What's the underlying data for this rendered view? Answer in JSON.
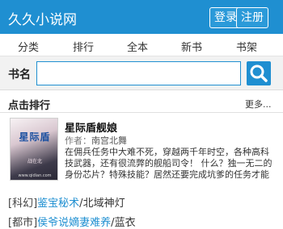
{
  "header": {
    "site_title": "久久小说网",
    "login_label": "登录",
    "register_label": "注册"
  },
  "nav": {
    "items": [
      "分类",
      "排行",
      "全本",
      "新书",
      "书架"
    ]
  },
  "search": {
    "label": "书名",
    "value": "",
    "placeholder": ""
  },
  "section": {
    "title": "点击排行",
    "more_label": "更多..."
  },
  "featured_book": {
    "cover_title": "星际盾",
    "cover_subtitle": "战在北",
    "cover_url": "www.qidian.com",
    "title": "星际盾舰娘",
    "author_label": "作者：",
    "author": "南宫北舞",
    "description": "在佣兵任务中大难不死，穿越两千年时空，各种高科技武器，还有很流弊的舰船司令！ 什么？独一无二的身份芯片？特殊技能？居然还要完成坑爹的任务才能获"
  },
  "list": [
    {
      "tag": "[科幻]",
      "title": "鉴宝秘术",
      "author": "北域神灯"
    },
    {
      "tag": "[都市]",
      "title": "侯爷说嫡妻难养",
      "author": "蓝衣"
    }
  ],
  "colors": {
    "brand": "#1f8fd1",
    "link": "#1f8fd1"
  }
}
